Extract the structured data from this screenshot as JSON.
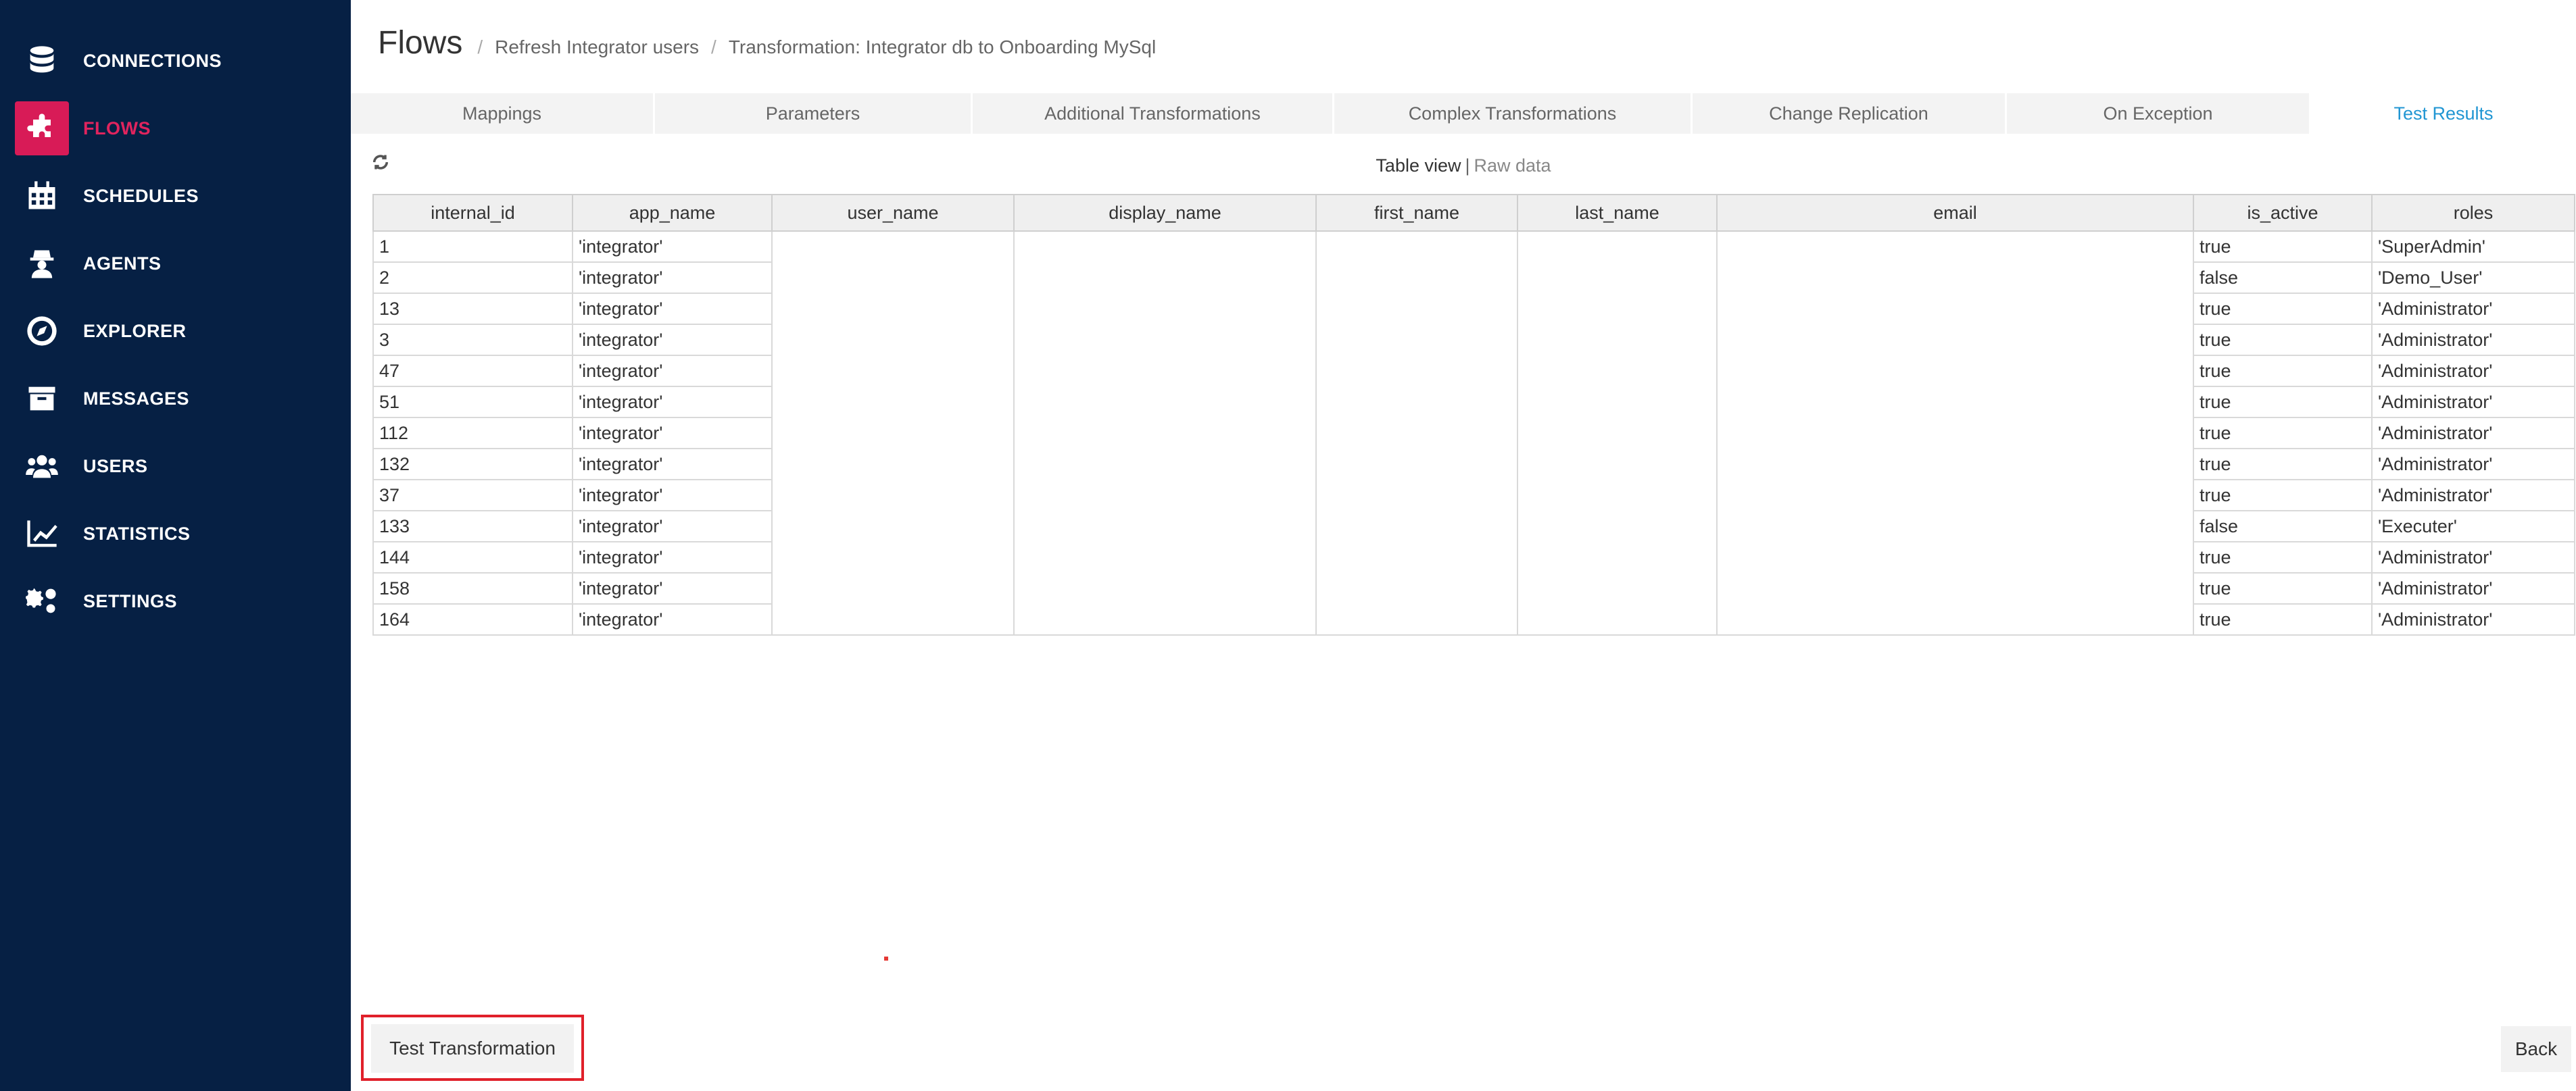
{
  "sidebar": {
    "items": [
      {
        "label": "CONNECTIONS",
        "icon": "database-icon"
      },
      {
        "label": "FLOWS",
        "icon": "puzzle-icon",
        "active": true
      },
      {
        "label": "SCHEDULES",
        "icon": "calendar-icon"
      },
      {
        "label": "AGENTS",
        "icon": "agent-icon"
      },
      {
        "label": "EXPLORER",
        "icon": "compass-icon"
      },
      {
        "label": "MESSAGES",
        "icon": "archive-icon"
      },
      {
        "label": "USERS",
        "icon": "users-icon"
      },
      {
        "label": "STATISTICS",
        "icon": "line-chart-icon"
      },
      {
        "label": "SETTINGS",
        "icon": "gears-icon"
      }
    ],
    "background": "#062044",
    "active_color": "#d81b57"
  },
  "header": {
    "title": "Flows",
    "breadcrumbs": [
      "Refresh Integrator users",
      "Transformation: Integrator db to Onboarding MySql"
    ],
    "separator": "/"
  },
  "tabs": [
    {
      "label": "Mappings"
    },
    {
      "label": "Parameters"
    },
    {
      "label": "Additional Transformations"
    },
    {
      "label": "Complex Transformations"
    },
    {
      "label": "Change Replication"
    },
    {
      "label": "On Exception"
    },
    {
      "label": "Test Results",
      "active": true
    }
  ],
  "view_toggle": {
    "table_view": "Table view",
    "separator": "|",
    "raw_data": "Raw data"
  },
  "table": {
    "columns": [
      "internal_id",
      "app_name",
      "user_name",
      "display_name",
      "first_name",
      "last_name",
      "email",
      "is_active",
      "roles"
    ],
    "rows": [
      [
        "1",
        "'integrator'",
        "",
        "",
        "",
        "",
        "",
        "true",
        "'SuperAdmin'"
      ],
      [
        "2",
        "'integrator'",
        "",
        "",
        "",
        "",
        "",
        "false",
        "'Demo_User'"
      ],
      [
        "13",
        "'integrator'",
        "",
        "",
        "",
        "",
        "",
        "true",
        "'Administrator'"
      ],
      [
        "3",
        "'integrator'",
        "",
        "",
        "",
        "",
        "",
        "true",
        "'Administrator'"
      ],
      [
        "47",
        "'integrator'",
        "",
        "",
        "",
        "",
        "",
        "true",
        "'Administrator'"
      ],
      [
        "51",
        "'integrator'",
        "",
        "",
        "",
        "",
        "",
        "true",
        "'Administrator'"
      ],
      [
        "112",
        "'integrator'",
        "",
        "",
        "",
        "",
        "",
        "true",
        "'Administrator'"
      ],
      [
        "132",
        "'integrator'",
        "",
        "",
        "",
        "",
        "",
        "true",
        "'Administrator'"
      ],
      [
        "37",
        "'integrator'",
        "",
        "",
        "",
        "",
        "",
        "true",
        "'Administrator'"
      ],
      [
        "133",
        "'integrator'",
        "",
        "",
        "",
        "",
        "",
        "false",
        "'Executer'"
      ],
      [
        "144",
        "'integrator'",
        "",
        "",
        "",
        "",
        "",
        "true",
        "'Administrator'"
      ],
      [
        "158",
        "'integrator'",
        "",
        "",
        "",
        "",
        "",
        "true",
        "'Administrator'"
      ],
      [
        "164",
        "'integrator'",
        "",
        "",
        "",
        "",
        "",
        "true",
        "'Administrator'"
      ]
    ]
  },
  "footer": {
    "test_button": "Test Transformation",
    "back_button": "Back"
  },
  "colors": {
    "tab_active": "#2196d3",
    "highlight_box": "#e0202a"
  }
}
